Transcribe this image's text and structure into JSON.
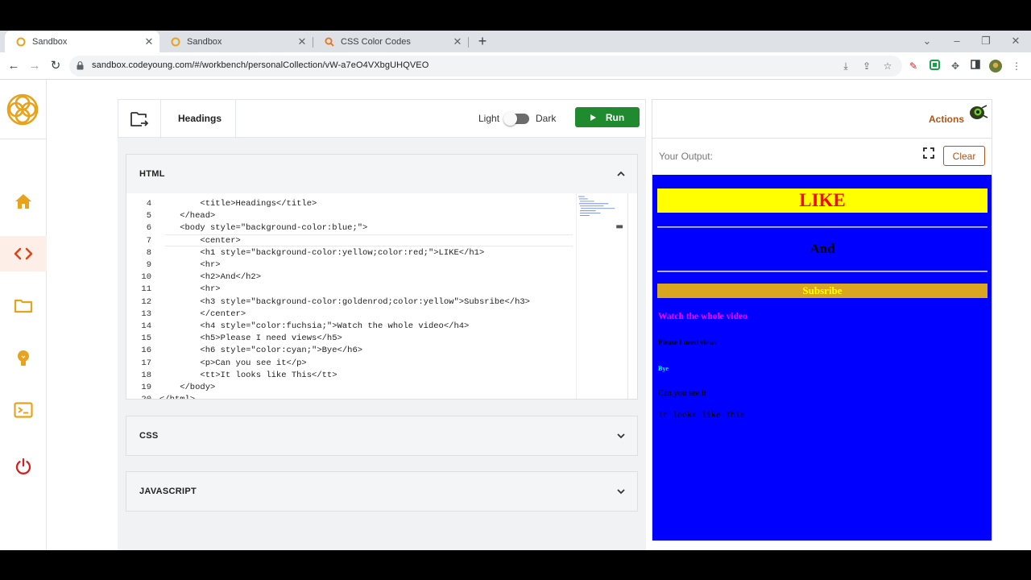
{
  "browser": {
    "tabs": [
      {
        "title": "Sandbox",
        "favicon": "codeyoung-icon",
        "active": true
      },
      {
        "title": "Sandbox",
        "favicon": "codeyoung-icon",
        "active": false
      },
      {
        "title": "CSS Color Codes",
        "favicon": "search-icon",
        "active": false
      }
    ],
    "url": "sandbox.codeyoung.com/#/workbench/personalCollection/vW-a7eO4VXbgUHQVEO"
  },
  "sidebar": {
    "items": [
      {
        "name": "home-icon",
        "active": false
      },
      {
        "name": "code-icon",
        "active": true
      },
      {
        "name": "folder-icon",
        "active": false
      },
      {
        "name": "lightbulb-icon",
        "active": false
      },
      {
        "name": "terminal-icon",
        "active": false
      },
      {
        "name": "power-icon",
        "active": false
      }
    ],
    "accent": "#e8a21b",
    "active_accent": "#d9471a"
  },
  "editor": {
    "project_title": "Headings",
    "theme_light_label": "Light",
    "theme_dark_label": "Dark",
    "run_label": "Run",
    "panels": {
      "html": "HTML",
      "css": "CSS",
      "javascript": "JAVASCRIPT"
    },
    "code_lines": [
      {
        "n": "4",
        "text": "        <title>Headings</title>"
      },
      {
        "n": "5",
        "text": "    </head>"
      },
      {
        "n": "6",
        "text": "    <body style=\"background-color:blue;\">"
      },
      {
        "n": "7",
        "text": "        <center>"
      },
      {
        "n": "8",
        "text": "        <h1 style=\"background-color:yellow;color:red;\">LIKE</h1>"
      },
      {
        "n": "9",
        "text": "        <hr>"
      },
      {
        "n": "10",
        "text": "        <h2>And</h2>"
      },
      {
        "n": "11",
        "text": "        <hr>"
      },
      {
        "n": "12",
        "text": "        <h3 style=\"background-color:goldenrod;color:yellow\">Subsribe</h3>"
      },
      {
        "n": "13",
        "text": "        </center>"
      },
      {
        "n": "14",
        "text": "        <h4 style=\"color:fuchsia;\">Watch the whole video</h4>"
      },
      {
        "n": "15",
        "text": "        <h5>Please I need views</h5>"
      },
      {
        "n": "16",
        "text": "        <h6 style=\"color:cyan;\">Bye</h6>"
      },
      {
        "n": "17",
        "text": "        <p>Can you see it</p>"
      },
      {
        "n": "18",
        "text": "        <tt>It looks like This</tt>"
      },
      {
        "n": "19",
        "text": "    </body>"
      },
      {
        "n": "20",
        "text": "</html>"
      }
    ]
  },
  "output": {
    "actions_label": "Actions",
    "your_output_label": "Your Output:",
    "clear_label": "Clear",
    "preview": {
      "h1": "LIKE",
      "h2": "And",
      "h3": "Subsribe",
      "h4": "Watch the whole video",
      "h5": "Please I need views",
      "h6": "Bye",
      "p": "Can you see it",
      "tt": "It looks like This"
    }
  }
}
